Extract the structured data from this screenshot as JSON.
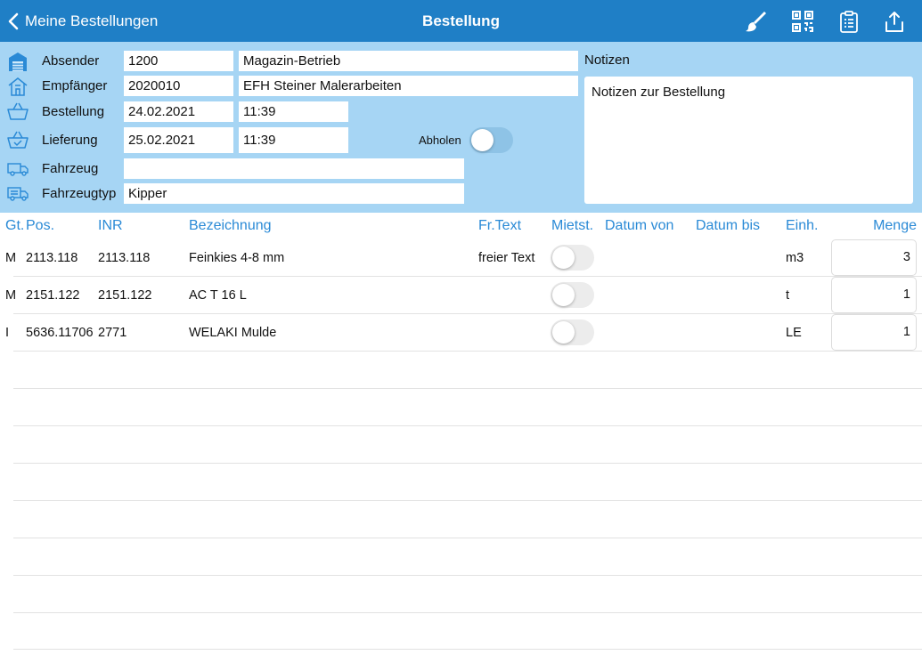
{
  "nav": {
    "back_label": "Meine Bestellungen",
    "title": "Bestellung",
    "icons": [
      "brush-icon",
      "qr-code-icon",
      "clipboard-icon",
      "share-icon"
    ]
  },
  "header": {
    "absender": {
      "label": "Absender",
      "code": "1200",
      "name": "Magazin-Betrieb"
    },
    "empfaenger": {
      "label": "Empfänger",
      "code": "2020010",
      "name": "EFH Steiner Malerarbeiten"
    },
    "bestellung": {
      "label": "Bestellung",
      "date": "24.02.2021",
      "time": "11:39"
    },
    "lieferung": {
      "label": "Lieferung",
      "date": "25.02.2021",
      "time": "11:39"
    },
    "fahrzeug": {
      "label": "Fahrzeug",
      "value": ""
    },
    "fahrzeugtyp": {
      "label": "Fahrzeugtyp",
      "value": "Kipper"
    },
    "abholen": {
      "label": "Abholen",
      "on": false
    },
    "notes": {
      "label": "Notizen",
      "value": "Notizen zur Bestellung"
    }
  },
  "table": {
    "columns": {
      "gt": "Gt.",
      "pos": "Pos.",
      "inr": "INR",
      "bez": "Bezeichnung",
      "frtext": "Fr.Text",
      "mietst": "Mietst.",
      "von": "Datum von",
      "bis": "Datum bis",
      "einh": "Einh.",
      "menge": "Menge"
    },
    "rows": [
      {
        "gt": "M",
        "pos": "2113.118",
        "inr": "2113.118",
        "bez": "Feinkies 4-8 mm",
        "frtext": "freier Text",
        "mietst": false,
        "von": "",
        "bis": "",
        "einh": "m3",
        "menge": "3"
      },
      {
        "gt": "M",
        "pos": "2151.122",
        "inr": "2151.122",
        "bez": "AC T 16 L",
        "frtext": "",
        "mietst": false,
        "von": "",
        "bis": "",
        "einh": "t",
        "menge": "1"
      },
      {
        "gt": "I",
        "pos": "5636.11706",
        "inr": "2771",
        "bez": "WELAKI Mulde",
        "frtext": "",
        "mietst": false,
        "von": "",
        "bis": "",
        "einh": "LE",
        "menge": "1"
      }
    ]
  },
  "colors": {
    "nav_bg": "#1f7fc6",
    "header_bg": "#a6d5f4",
    "column_header": "#2a8ad6",
    "icon_blue": "#2a8ad6"
  }
}
